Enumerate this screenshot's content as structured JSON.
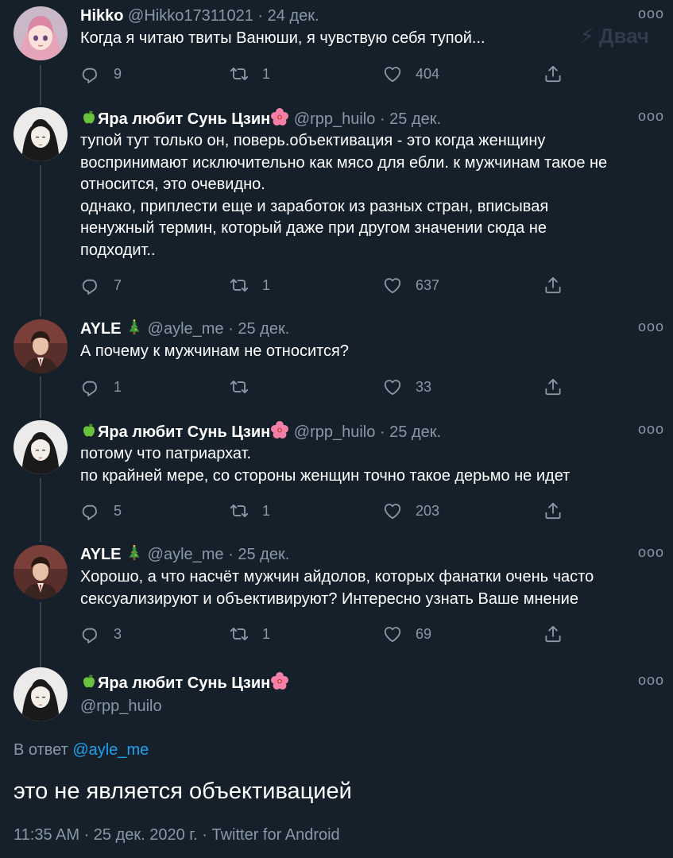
{
  "watermark": "Двач",
  "tweets": [
    {
      "name": "Hikko",
      "handle": "@Hikko17311021",
      "date": "24 дек.",
      "text": "Когда я читаю твиты Ванюши, я чувствую себя тупой...",
      "replies": "9",
      "retweets": "1",
      "likes": "404"
    },
    {
      "name": "Яра любит Сунь Цзин",
      "handle": "@rpp_huilo",
      "date": "25 дек.",
      "text": "тупой тут только он, поверь.объективация - это когда женщину\nвоспринимают исключительно как мясо для ебли. к мужчинам такое не\nотносится, это очевидно.\nоднако, приплести еще и заработок из разных стран, вписывая\nненужный термин, который даже при другом значении сюда не\nподходит..",
      "replies": "7",
      "retweets": "1",
      "likes": "637"
    },
    {
      "name": "AYLE",
      "handle": "@ayle_me",
      "date": "25 дек.",
      "text": "А почему к мужчинам не относится?",
      "replies": "1",
      "retweets": "",
      "likes": "33"
    },
    {
      "name": "Яра любит Сунь Цзин",
      "handle": "@rpp_huilo",
      "date": "25 дек.",
      "text": "потому что патриархат.\nпо крайней мере, со стороны женщин точно такое дерьмо не идет",
      "replies": "5",
      "retweets": "1",
      "likes": "203"
    },
    {
      "name": "AYLE",
      "handle": "@ayle_me",
      "date": "25 дек.",
      "text": "Хорошо, а что насчёт мужчин айдолов, которых фанатки очень часто\nсексуализируют и объективируют? Интересно узнать Ваше мнение",
      "replies": "3",
      "retweets": "1",
      "likes": "69"
    }
  ],
  "main_tweet": {
    "name": "Яра любит Сунь Цзин",
    "handle": "@rpp_huilo",
    "reply_prefix": "В ответ",
    "reply_handle": "@ayle_me",
    "text": "это не является объективацией",
    "meta": "11:35 AM · 25 дек. 2020 г. · Twitter for Android"
  },
  "dot": "·",
  "icons": {
    "reply": "reply-icon",
    "retweet": "retweet-icon",
    "like": "heart-icon",
    "share": "share-icon",
    "more": "more-icon",
    "apple": "green-apple-icon",
    "flower": "hibiscus-icon",
    "tree": "christmas-tree-icon"
  },
  "colors": {
    "background": "#15202b",
    "secondary_text": "#8899a6",
    "link": "#1da1f2",
    "thread_line": "#38444d"
  }
}
